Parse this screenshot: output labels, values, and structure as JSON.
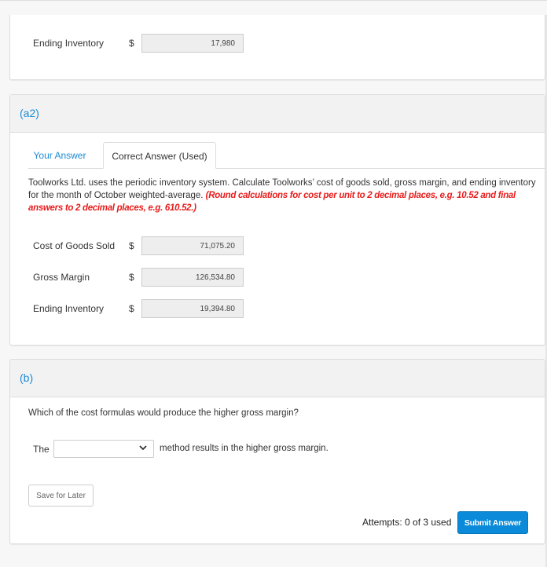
{
  "section_a1": {
    "ending_inventory": {
      "label": "Ending Inventory",
      "currency": "$",
      "value": "17,980"
    }
  },
  "section_a2": {
    "header": "(a2)",
    "tabs": [
      {
        "label": "Your Answer",
        "active": false
      },
      {
        "label": "Correct Answer (Used)",
        "active": true
      }
    ],
    "question_text": "Toolworks Ltd. uses the periodic inventory system. Calculate Toolworks’ cost of goods sold, gross margin, and ending inventory for the month of October weighted-average.",
    "question_note": "(Round calculations for cost per unit to 2 decimal places, e.g. 10.52 and final answers to 2 decimal places, e.g. 610.52.)",
    "rows": [
      {
        "label": "Cost of Goods Sold",
        "currency": "$",
        "value": "71,075.20"
      },
      {
        "label": "Gross Margin",
        "currency": "$",
        "value": "126,534.80"
      },
      {
        "label": "Ending Inventory",
        "currency": "$",
        "value": "19,394.80"
      }
    ]
  },
  "section_b": {
    "header": "(b)",
    "question_text": "Which of the cost formulas would produce the higher gross margin?",
    "sentence_prefix": "The",
    "select_value": "",
    "sentence_suffix": "method results in the higher gross margin."
  },
  "actions": {
    "save_label": "Save for Later",
    "attempts": "Attempts: 0 of 3 used",
    "submit_label": "Submit Answer"
  }
}
